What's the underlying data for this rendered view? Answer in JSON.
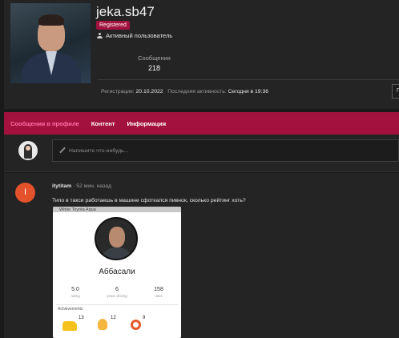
{
  "profile": {
    "username": "jeka.sb47",
    "badge": "Registered",
    "status": "Активный пользователь",
    "stat_label": "Сообщения",
    "stat_value": "218",
    "reg_label": "Регистрация:",
    "reg_value": "20.10.2022",
    "activity_label": "Последняя активность:",
    "activity_value": "Сегодня в 19:36",
    "follow_label": "По"
  },
  "tabs": [
    {
      "label": "Сообщения в профиле"
    },
    {
      "label": "Контент"
    },
    {
      "label": "Информация"
    }
  ],
  "composer": {
    "placeholder": "Напишите что-нибудь..."
  },
  "post": {
    "avatar_letter": "I",
    "author": "itytitam",
    "time": "· 52 мин. назад",
    "text": "Типо в такси работаешь в машине сфоткался пивнок, сколько рейтинг хоть?",
    "image": {
      "top_text": "White Toyota Aqua",
      "driver_name": "Аббасали",
      "stats": [
        {
          "value": "5.0",
          "label": "rating"
        },
        {
          "value": "6",
          "label": "years driving"
        },
        {
          "value": "158",
          "label": "rides"
        }
      ],
      "achievements_label": "Achievements",
      "achievements": [
        {
          "icon": "car-icon",
          "count": "13"
        },
        {
          "icon": "thumbs-up-icon",
          "count": "12"
        },
        {
          "icon": "target-icon",
          "count": "9"
        }
      ]
    }
  },
  "colors": {
    "accent": "#a3123f",
    "active_tab": "#ff6fa4",
    "page_bg": "#1a1a1a",
    "card_bg": "#242424",
    "avatar_letter_bg": "#e4522b"
  }
}
